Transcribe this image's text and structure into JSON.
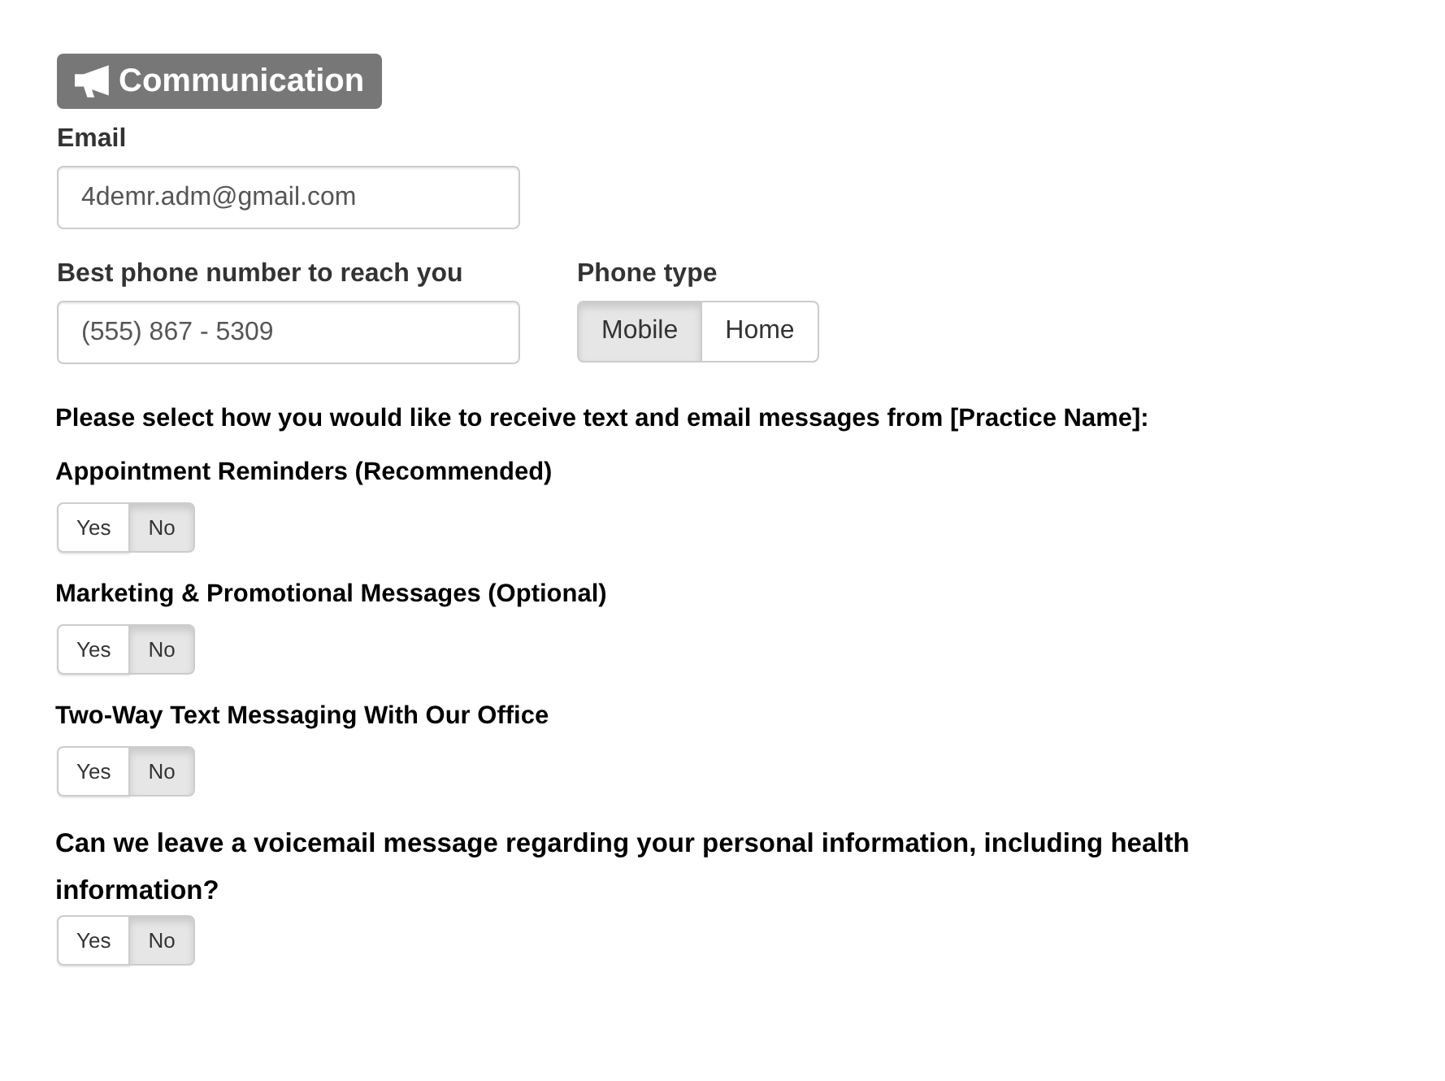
{
  "section": {
    "title": "Communication"
  },
  "email": {
    "label": "Email",
    "value": "4demr.adm@gmail.com"
  },
  "phone": {
    "label": "Best phone number to reach you",
    "placeholder": "(555) 867 - 5309"
  },
  "phone_type": {
    "label": "Phone type",
    "options": [
      {
        "label": "Mobile",
        "selected": true
      },
      {
        "label": "Home",
        "selected": false
      }
    ]
  },
  "preferences": {
    "intro": "Please select how you would like to receive text and email messages from [Practice Name]:",
    "items": [
      {
        "kind": "standard",
        "label": "Appointment Reminders (Recommended)",
        "options": [
          {
            "label": "Yes",
            "selected": false
          },
          {
            "label": "No",
            "selected": true
          }
        ]
      },
      {
        "kind": "standard",
        "label": "Marketing & Promotional Messages (Optional)",
        "options": [
          {
            "label": "Yes",
            "selected": false
          },
          {
            "label": "No",
            "selected": true
          }
        ]
      },
      {
        "kind": "standard",
        "label": "Two-Way Text Messaging With Our Office",
        "options": [
          {
            "label": "Yes",
            "selected": false
          },
          {
            "label": "No",
            "selected": true
          }
        ]
      },
      {
        "kind": "question",
        "label": "Can we leave a voicemail message regarding your personal information, including health information?",
        "options": [
          {
            "label": "Yes",
            "selected": false
          },
          {
            "label": "No",
            "selected": true
          }
        ]
      }
    ]
  }
}
